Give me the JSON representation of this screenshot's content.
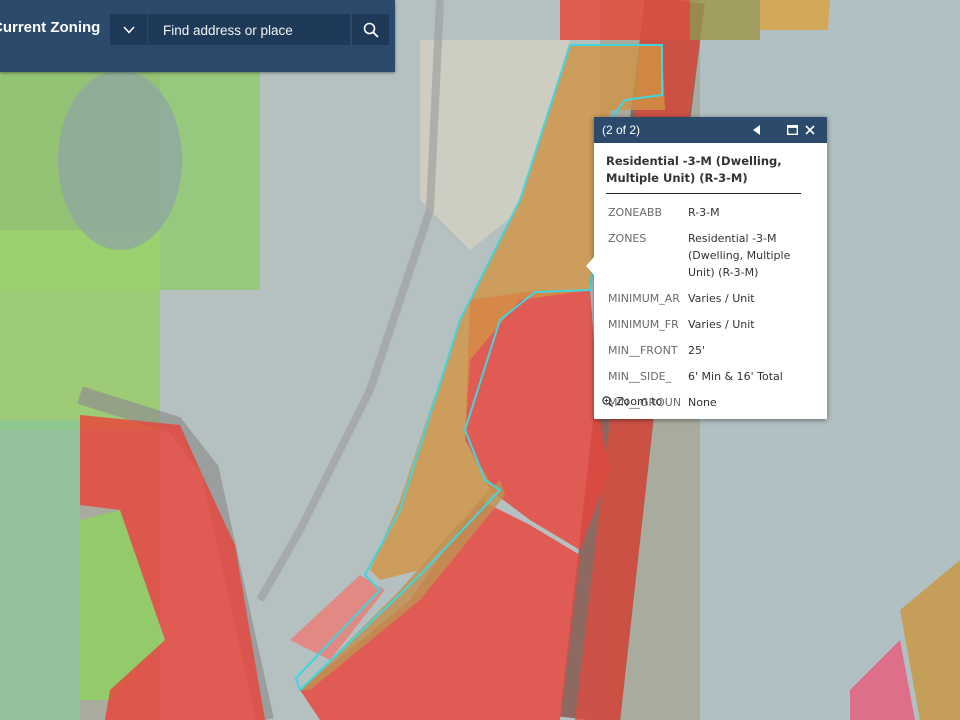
{
  "app": {
    "title": "Current Zoning"
  },
  "search": {
    "placeholder": "Find address or place"
  },
  "icons": {
    "dropdown": "chevron-down-icon",
    "search": "search-icon",
    "previous": "triangle-left-icon",
    "maximize": "maximize-icon",
    "close": "close-icon",
    "zoom": "zoom-in-icon"
  },
  "colors": {
    "header": "#2b4a6c",
    "commercial_red": "#e8443c",
    "residential_orange": "#d59a4c",
    "selection_cyan": "#3fd6e0",
    "park_green": "#7fcc63"
  },
  "popup": {
    "count": "(2 of 2)",
    "title": "Residential -3-M (Dwelling, Multiple Unit) (R-3-M)",
    "attributes": [
      {
        "key": "ZONEABB",
        "value": "R-3-M"
      },
      {
        "key": "ZONES",
        "value": "Residential -3-M (Dwelling, Multiple Unit) (R-3-M)"
      },
      {
        "key": "MINIMUM_AR",
        "value": "Varies / Unit"
      },
      {
        "key": "MINIMUM_FR",
        "value": "Varies / Unit"
      },
      {
        "key": "MIN__FRONT",
        "value": "25'"
      },
      {
        "key": "MIN__SIDE_",
        "value": "6' Min & 16' Total"
      },
      {
        "key": "MIN__GROUN",
        "value": "None"
      }
    ],
    "zoom_label": "Zoom to"
  }
}
